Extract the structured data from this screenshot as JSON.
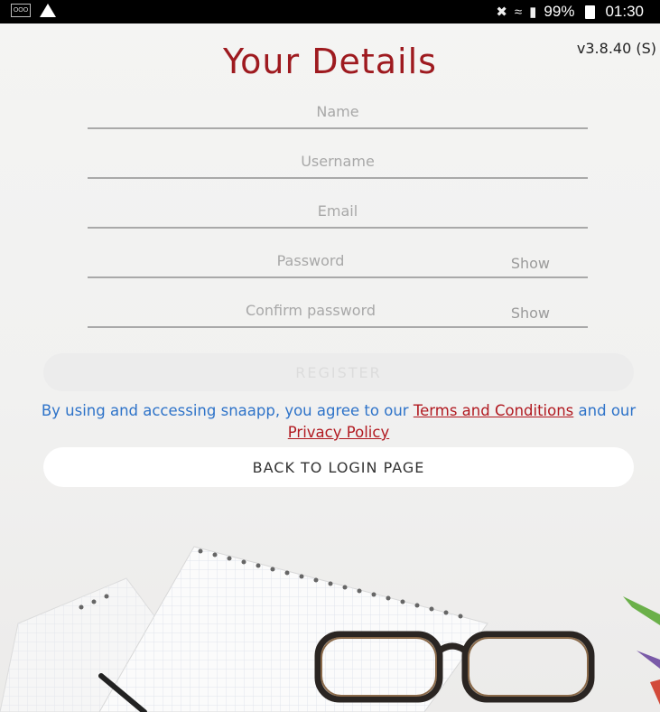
{
  "status_bar": {
    "battery": "99%",
    "time": "01:30",
    "left_box_text": "OOO"
  },
  "version": "v3.8.40 (S)",
  "title": "Your Details",
  "form": {
    "name_placeholder": "Name",
    "username_placeholder": "Username",
    "email_placeholder": "Email",
    "password_placeholder": "Password",
    "confirm_placeholder": "Confirm password",
    "show_label": "Show"
  },
  "register_label": "REGISTER",
  "terms": {
    "prefix": "By using and accessing snaapp, you agree to our ",
    "terms_link": "Terms and Conditions",
    "middle": " and our ",
    "privacy_link": "Privacy Policy"
  },
  "back_label": "BACK TO LOGIN PAGE",
  "colors": {
    "title": "#9e1a1f",
    "link": "#b11920",
    "terms_text": "#2e73c9"
  }
}
